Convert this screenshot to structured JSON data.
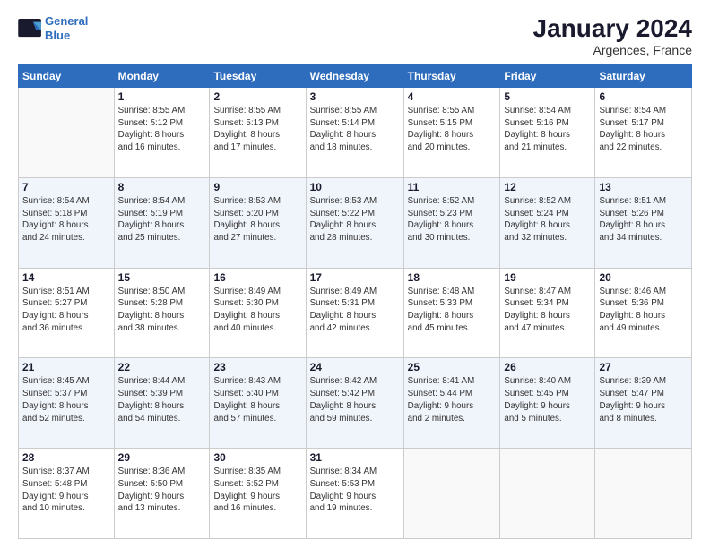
{
  "logo": {
    "line1": "General",
    "line2": "Blue"
  },
  "header": {
    "month_year": "January 2024",
    "location": "Argences, France"
  },
  "weekdays": [
    "Sunday",
    "Monday",
    "Tuesday",
    "Wednesday",
    "Thursday",
    "Friday",
    "Saturday"
  ],
  "weeks": [
    [
      {
        "day": "",
        "info": ""
      },
      {
        "day": "1",
        "info": "Sunrise: 8:55 AM\nSunset: 5:12 PM\nDaylight: 8 hours\nand 16 minutes."
      },
      {
        "day": "2",
        "info": "Sunrise: 8:55 AM\nSunset: 5:13 PM\nDaylight: 8 hours\nand 17 minutes."
      },
      {
        "day": "3",
        "info": "Sunrise: 8:55 AM\nSunset: 5:14 PM\nDaylight: 8 hours\nand 18 minutes."
      },
      {
        "day": "4",
        "info": "Sunrise: 8:55 AM\nSunset: 5:15 PM\nDaylight: 8 hours\nand 20 minutes."
      },
      {
        "day": "5",
        "info": "Sunrise: 8:54 AM\nSunset: 5:16 PM\nDaylight: 8 hours\nand 21 minutes."
      },
      {
        "day": "6",
        "info": "Sunrise: 8:54 AM\nSunset: 5:17 PM\nDaylight: 8 hours\nand 22 minutes."
      }
    ],
    [
      {
        "day": "7",
        "info": "Sunrise: 8:54 AM\nSunset: 5:18 PM\nDaylight: 8 hours\nand 24 minutes."
      },
      {
        "day": "8",
        "info": "Sunrise: 8:54 AM\nSunset: 5:19 PM\nDaylight: 8 hours\nand 25 minutes."
      },
      {
        "day": "9",
        "info": "Sunrise: 8:53 AM\nSunset: 5:20 PM\nDaylight: 8 hours\nand 27 minutes."
      },
      {
        "day": "10",
        "info": "Sunrise: 8:53 AM\nSunset: 5:22 PM\nDaylight: 8 hours\nand 28 minutes."
      },
      {
        "day": "11",
        "info": "Sunrise: 8:52 AM\nSunset: 5:23 PM\nDaylight: 8 hours\nand 30 minutes."
      },
      {
        "day": "12",
        "info": "Sunrise: 8:52 AM\nSunset: 5:24 PM\nDaylight: 8 hours\nand 32 minutes."
      },
      {
        "day": "13",
        "info": "Sunrise: 8:51 AM\nSunset: 5:26 PM\nDaylight: 8 hours\nand 34 minutes."
      }
    ],
    [
      {
        "day": "14",
        "info": "Sunrise: 8:51 AM\nSunset: 5:27 PM\nDaylight: 8 hours\nand 36 minutes."
      },
      {
        "day": "15",
        "info": "Sunrise: 8:50 AM\nSunset: 5:28 PM\nDaylight: 8 hours\nand 38 minutes."
      },
      {
        "day": "16",
        "info": "Sunrise: 8:49 AM\nSunset: 5:30 PM\nDaylight: 8 hours\nand 40 minutes."
      },
      {
        "day": "17",
        "info": "Sunrise: 8:49 AM\nSunset: 5:31 PM\nDaylight: 8 hours\nand 42 minutes."
      },
      {
        "day": "18",
        "info": "Sunrise: 8:48 AM\nSunset: 5:33 PM\nDaylight: 8 hours\nand 45 minutes."
      },
      {
        "day": "19",
        "info": "Sunrise: 8:47 AM\nSunset: 5:34 PM\nDaylight: 8 hours\nand 47 minutes."
      },
      {
        "day": "20",
        "info": "Sunrise: 8:46 AM\nSunset: 5:36 PM\nDaylight: 8 hours\nand 49 minutes."
      }
    ],
    [
      {
        "day": "21",
        "info": "Sunrise: 8:45 AM\nSunset: 5:37 PM\nDaylight: 8 hours\nand 52 minutes."
      },
      {
        "day": "22",
        "info": "Sunrise: 8:44 AM\nSunset: 5:39 PM\nDaylight: 8 hours\nand 54 minutes."
      },
      {
        "day": "23",
        "info": "Sunrise: 8:43 AM\nSunset: 5:40 PM\nDaylight: 8 hours\nand 57 minutes."
      },
      {
        "day": "24",
        "info": "Sunrise: 8:42 AM\nSunset: 5:42 PM\nDaylight: 8 hours\nand 59 minutes."
      },
      {
        "day": "25",
        "info": "Sunrise: 8:41 AM\nSunset: 5:44 PM\nDaylight: 9 hours\nand 2 minutes."
      },
      {
        "day": "26",
        "info": "Sunrise: 8:40 AM\nSunset: 5:45 PM\nDaylight: 9 hours\nand 5 minutes."
      },
      {
        "day": "27",
        "info": "Sunrise: 8:39 AM\nSunset: 5:47 PM\nDaylight: 9 hours\nand 8 minutes."
      }
    ],
    [
      {
        "day": "28",
        "info": "Sunrise: 8:37 AM\nSunset: 5:48 PM\nDaylight: 9 hours\nand 10 minutes."
      },
      {
        "day": "29",
        "info": "Sunrise: 8:36 AM\nSunset: 5:50 PM\nDaylight: 9 hours\nand 13 minutes."
      },
      {
        "day": "30",
        "info": "Sunrise: 8:35 AM\nSunset: 5:52 PM\nDaylight: 9 hours\nand 16 minutes."
      },
      {
        "day": "31",
        "info": "Sunrise: 8:34 AM\nSunset: 5:53 PM\nDaylight: 9 hours\nand 19 minutes."
      },
      {
        "day": "",
        "info": ""
      },
      {
        "day": "",
        "info": ""
      },
      {
        "day": "",
        "info": ""
      }
    ]
  ]
}
